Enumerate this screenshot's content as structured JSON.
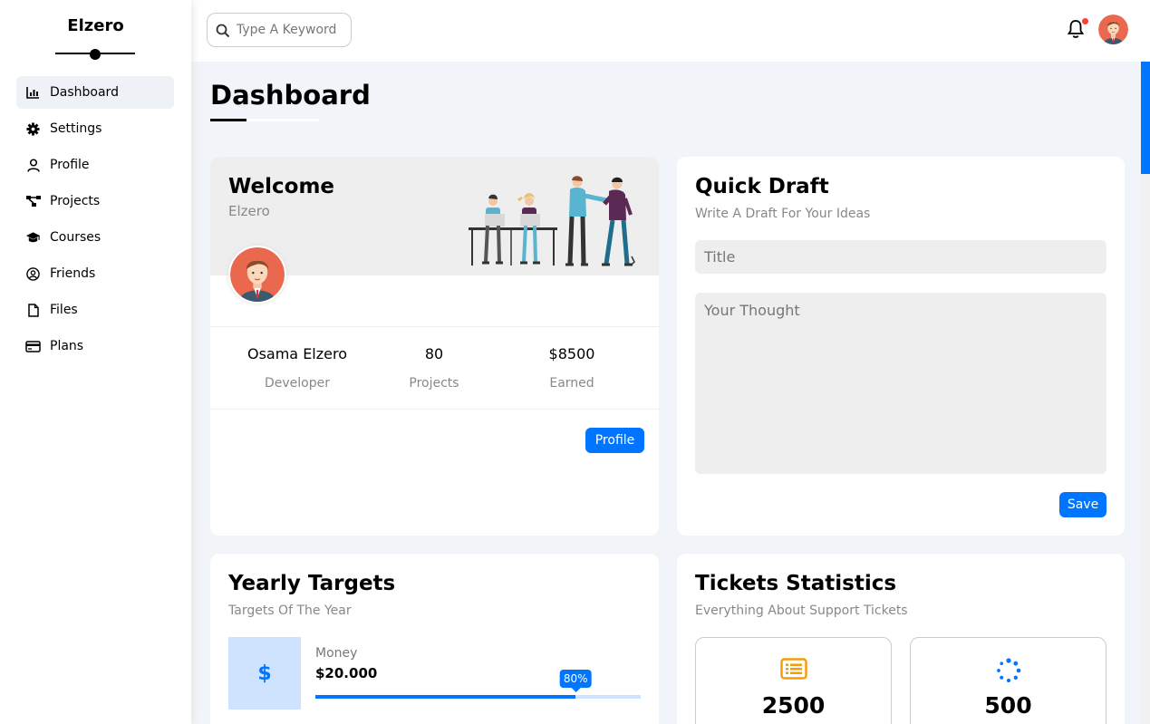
{
  "brand": {
    "name": "Elzero"
  },
  "sidebar": {
    "items": [
      {
        "label": "Dashboard",
        "icon": "chart-icon",
        "active": true
      },
      {
        "label": "Settings",
        "icon": "gear-icon"
      },
      {
        "label": "Profile",
        "icon": "user-icon"
      },
      {
        "label": "Projects",
        "icon": "diagram-icon"
      },
      {
        "label": "Courses",
        "icon": "graduation-cap-icon"
      },
      {
        "label": "Friends",
        "icon": "user-circle-icon"
      },
      {
        "label": "Files",
        "icon": "file-icon"
      },
      {
        "label": "Plans",
        "icon": "credit-card-icon"
      }
    ]
  },
  "header": {
    "search_placeholder": "Type A Keyword",
    "notification_dot_color": "#f44336"
  },
  "page": {
    "title": "Dashboard"
  },
  "welcome": {
    "title": "Welcome",
    "subtitle": "Elzero",
    "stats": [
      {
        "value": "Osama Elzero",
        "label": "Developer"
      },
      {
        "value": "80",
        "label": "Projects"
      },
      {
        "value": "$8500",
        "label": "Earned"
      }
    ],
    "button": "Profile"
  },
  "draft": {
    "title": "Quick Draft",
    "subtitle": "Write A Draft For Your Ideas",
    "title_placeholder": "Title",
    "body_placeholder": "Your Thought",
    "button": "Save"
  },
  "yearly": {
    "title": "Yearly Targets",
    "subtitle": "Targets Of The Year",
    "money_label": "Money",
    "money_value": "$20.000",
    "money_percent_text": "80%",
    "money_percent": 80,
    "money_icon": "$"
  },
  "tickets": {
    "title": "Tickets Statistics",
    "subtitle": "Everything About Support Tickets",
    "boxes": [
      {
        "value": "2500",
        "icon": "list-icon",
        "color": "#f59e0b"
      },
      {
        "value": "500",
        "icon": "spinner-icon",
        "color": "#0075ff"
      }
    ]
  },
  "colors": {
    "accent": "#0075ff",
    "background": "#f1f5f9"
  }
}
